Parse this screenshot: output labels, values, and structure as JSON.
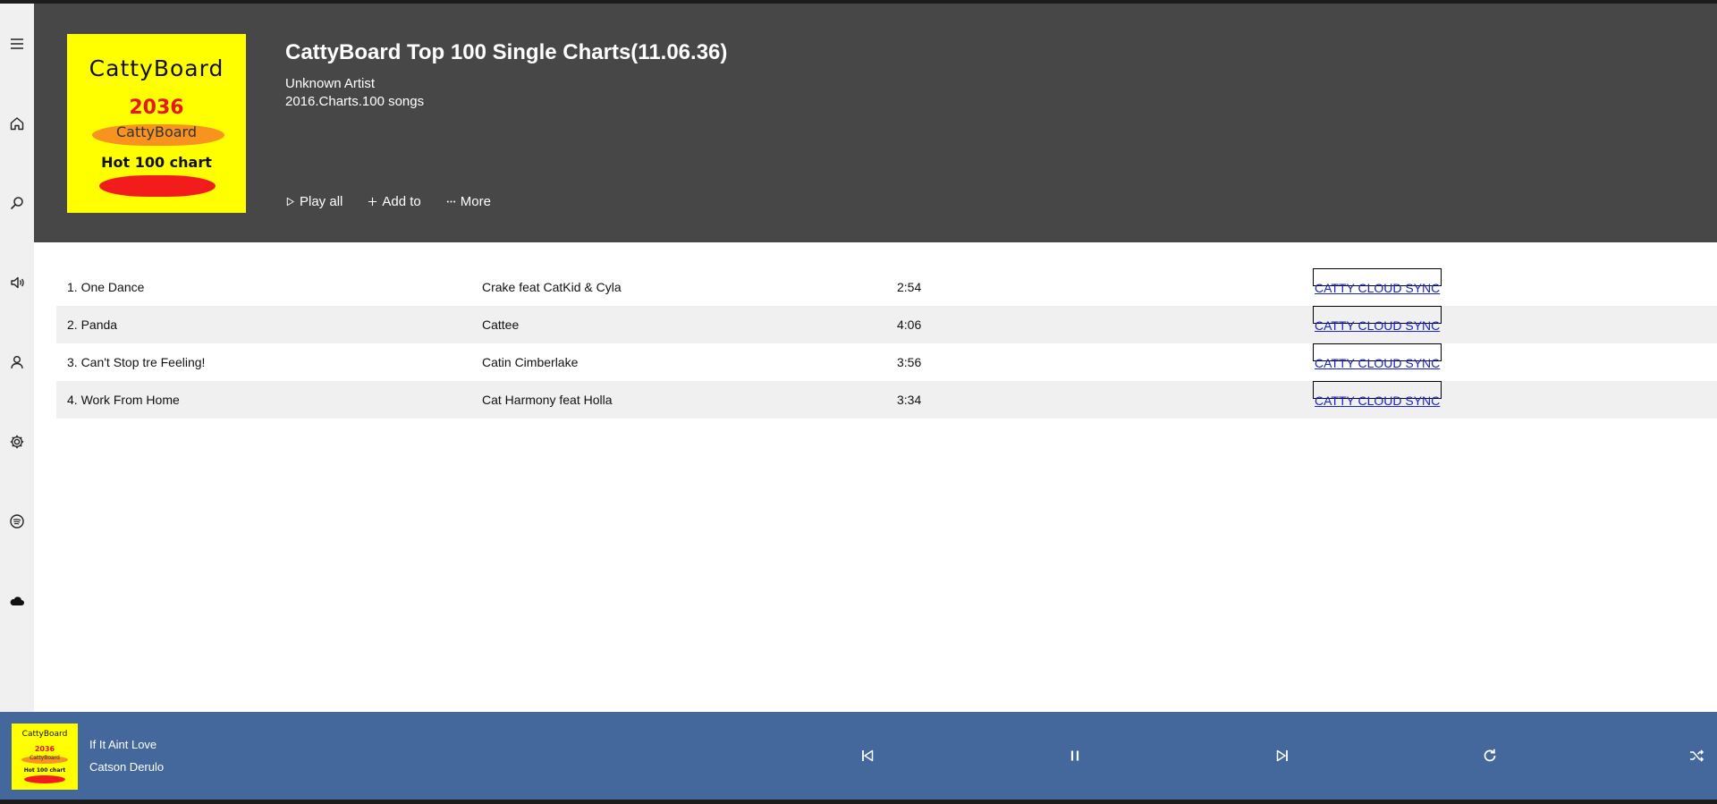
{
  "sidebar": {
    "icons": [
      "menu-icon",
      "home-icon",
      "search-icon",
      "volume-icon",
      "user-icon",
      "gear-icon",
      "spotify-icon",
      "cloud-icon"
    ]
  },
  "album": {
    "title": "CattyBoard Top 100 Single Charts(11.06.36)",
    "artist": "Unknown Artist",
    "meta": "2016.Charts.100 songs",
    "cover": {
      "brand": "CattyBoard",
      "year": "2036",
      "sub": "CattyBoard",
      "hot": "Hot 100 chart"
    }
  },
  "actions": {
    "play_all": "Play all",
    "add_to": "Add to",
    "more": "More"
  },
  "tracks": [
    {
      "title": "1. One Dance",
      "artist": "Crake feat CatKid & Cyla",
      "duration": "2:54",
      "sync": "CATTY CLOUD SYNC"
    },
    {
      "title": "2. Panda",
      "artist": "Cattee",
      "duration": "4:06",
      "sync": "CATTY CLOUD SYNC"
    },
    {
      "title": "3. Can't Stop tre Feeling!",
      "artist": "Catin Cimberlake",
      "duration": "3:56",
      "sync": "CATTY CLOUD SYNC"
    },
    {
      "title": "4. Work From Home",
      "artist": "Cat Harmony feat Holla",
      "duration": "3:34",
      "sync": "CATTY CLOUD SYNC"
    }
  ],
  "player": {
    "song": "If It Aint Love",
    "artist": "Catson Derulo",
    "cover": {
      "brand": "CattyBoard",
      "year": "2036",
      "sub": "CattyBoard",
      "hot": "Hot 100 chart"
    },
    "controls": [
      "previous-icon",
      "pause-icon",
      "next-icon",
      "repeat-icon",
      "shuffle-icon"
    ]
  },
  "colors": {
    "header_bg": "#474747",
    "sidebar_bg": "#f0f0f0",
    "player_bg": "#44689c",
    "row_alt_bg": "#f0f0f0",
    "link": "#1a23c9",
    "cover_bg": "#ffff00"
  }
}
